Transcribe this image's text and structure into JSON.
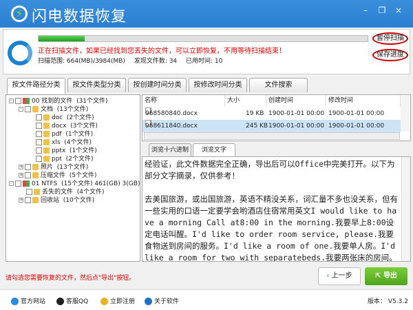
{
  "app": {
    "title": "闪电数据恢复",
    "logo_icon": "lightning-icon"
  },
  "window": {
    "minimize": "–",
    "restore": "❐",
    "close": "×"
  },
  "scan": {
    "progress_percent": 14,
    "message": "正在扫描文件，如果已经找到您丢失的文件，可以立即恢复，不用等待扫描结束！",
    "range": "扫描范围: 664(MB)/3984(MB)",
    "found": "发现文件数: 34",
    "elapsed": "已用时间: 10",
    "pause_button": "暂停扫描",
    "save_button": "保存进度"
  },
  "tabs": [
    "按文件路径分类",
    "按文件类型分类",
    "按创建时间分类",
    "按修改时间分类",
    "文件搜索"
  ],
  "tree": [
    {
      "label": "00  找到的文件",
      "count": "(31个文件)",
      "depth": 0,
      "type": "drive",
      "expander": "-"
    },
    {
      "label": "文档",
      "count": "(13个文件)",
      "depth": 1,
      "type": "folder",
      "expander": "-"
    },
    {
      "label": "doc",
      "count": "(2个文件)",
      "depth": 2,
      "type": "folder",
      "expander": ""
    },
    {
      "label": "docx",
      "count": "(3个文件)",
      "depth": 2,
      "type": "folder",
      "expander": ""
    },
    {
      "label": "pdf",
      "count": "(1个文件)",
      "depth": 2,
      "type": "folder",
      "expander": ""
    },
    {
      "label": "xls",
      "count": "(4个文件)",
      "depth": 2,
      "type": "folder",
      "expander": ""
    },
    {
      "label": "pptx",
      "count": "(1个文件)",
      "depth": 2,
      "type": "folder",
      "expander": ""
    },
    {
      "label": "ppt",
      "count": "(2个文件)",
      "depth": 2,
      "type": "folder",
      "expander": ""
    },
    {
      "label": "照片",
      "count": "(13个文件)",
      "depth": 1,
      "type": "folder",
      "expander": "+"
    },
    {
      "label": "压缩文件",
      "count": "(5个文件)",
      "depth": 1,
      "type": "folder",
      "expander": "+"
    },
    {
      "label": "01  NTFS",
      "count": "(15个文件) 461(GB) 3(GB)",
      "depth": 0,
      "type": "drive",
      "expander": "-"
    },
    {
      "label": "丢失的文件",
      "count": "(4个文件)",
      "depth": 1,
      "type": "folder",
      "expander": ""
    },
    {
      "label": "回收站",
      "count": "(10个文件)",
      "depth": 1,
      "type": "folder",
      "expander": "+"
    }
  ],
  "file_list": {
    "columns": [
      "名称",
      "大小",
      "创建时间",
      "修改时间"
    ],
    "rows": [
      {
        "name": "968580840.docx",
        "size": "19 KB",
        "created": "1900-01-01 00:00",
        "modified": "1900-01-01 00:00",
        "selected": false
      },
      {
        "name": "968611840.docx",
        "size": "245 KB",
        "created": "1900-01-01 00:00",
        "modified": "1900-01-01 00:00",
        "selected": true
      }
    ]
  },
  "preview": {
    "tabs": [
      "浏览十六进制",
      "浏览文字"
    ],
    "text_lines": [
      "经验证，此文件数据完全正确，导出后可以Office中完美打开。以下为部分文字摘录，仅供参考！",
      "",
      "去美国旅游，或出国旅游，英语不精没关系，词汇量不多也没关系，但有一些实用的口语一定要学会哟酒店住宿常用英文I would like to have a morning Call at8:00 in the morning.我要早上8:00设定电话叫醒。I'd like to order room service, please.我要食物送到房间的服务。I'd like a room of one.我要单人房。I'd like a room for two with separatebeds.我要两张床的房间。I'd like as extra bed for room"
    ]
  },
  "bottom": {
    "hint": "请勾选您需要恢复的文件，然后点\"导出\"按钮。",
    "back_button": "上一步",
    "export_button": "导出"
  },
  "footer": {
    "links": [
      "官方网站",
      "客服QQ",
      "立即注册",
      "关于软件"
    ],
    "version": "版本： V5.3.2"
  }
}
